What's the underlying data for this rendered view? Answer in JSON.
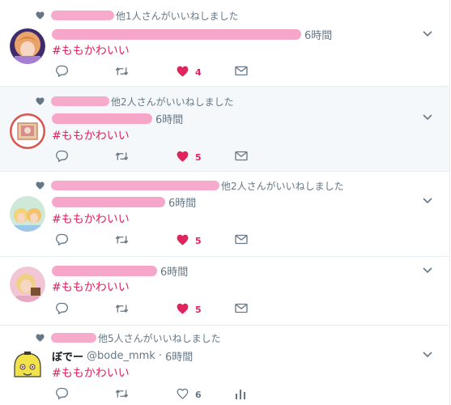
{
  "colors": {
    "like": "#e0245e",
    "muted": "#657786",
    "redaction": "#f6a6c9",
    "row_alt_bg": "#f5f8fa"
  },
  "icons": {
    "context": "heart-icon",
    "reply": "reply-icon",
    "retweet": "retweet-icon",
    "like": "heart-icon",
    "dm": "envelope-icon",
    "analytics": "bar-chart-icon",
    "menu": "chevron-down-icon"
  },
  "tweets": [
    {
      "context": "他1人さんがいいねしました",
      "time": "6時間",
      "hashtag": "#ももかわいい",
      "like_count": "4",
      "liked": true
    },
    {
      "context": "他2人さんがいいねしました",
      "time": "6時間",
      "hashtag": "#ももかわいい",
      "like_count": "5",
      "liked": true
    },
    {
      "context": "他2人さんがいいねしました",
      "time": "6時間",
      "hashtag": "#ももかわいい",
      "like_count": "5",
      "liked": true
    },
    {
      "time": "6時間",
      "hashtag": "#ももかわいい",
      "like_count": "5",
      "liked": true
    },
    {
      "context": "他5人さんがいいねしました",
      "name": "ぼでー",
      "handle": "@bode_mmk",
      "separator": "·",
      "time": "6時間",
      "hashtag": "#ももかわいい",
      "like_count": "6",
      "liked": false
    }
  ]
}
